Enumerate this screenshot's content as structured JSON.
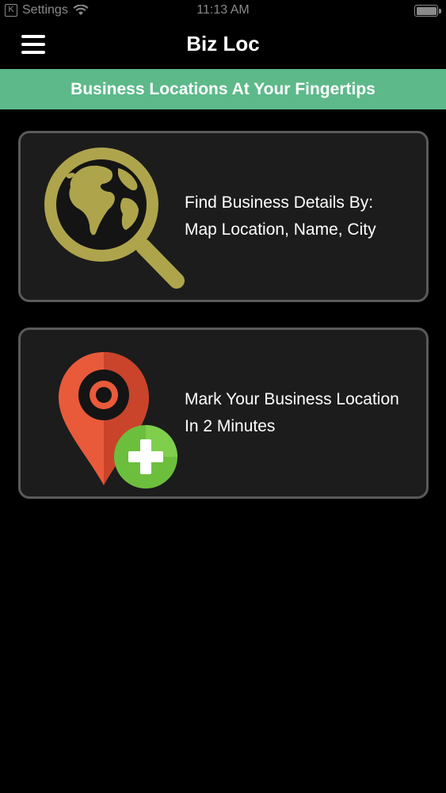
{
  "status_bar": {
    "back_label": "Settings",
    "time": "11:13 AM",
    "icons": [
      "back-arrow-icon",
      "wifi-icon",
      "battery-icon"
    ]
  },
  "nav": {
    "title": "Biz Loc",
    "menu_icon": "hamburger-menu-icon"
  },
  "banner": {
    "text": "Business Locations At Your Fingertips",
    "color": "#5db98a"
  },
  "cards": [
    {
      "icon": "globe-magnifier-icon",
      "line1": "Find Business Details By:",
      "line2": "Map Location, Name, City"
    },
    {
      "icon": "map-pin-add-icon",
      "line1": "Mark Your Business Location",
      "line2": "In 2 Minutes"
    }
  ],
  "colors": {
    "background": "#000000",
    "card_background": "#1c1c1c",
    "card_border": "#5a5a5a",
    "globe_gold": "#aea44c",
    "pin_red": "#e85a3a",
    "plus_green": "#6cbf3c"
  }
}
